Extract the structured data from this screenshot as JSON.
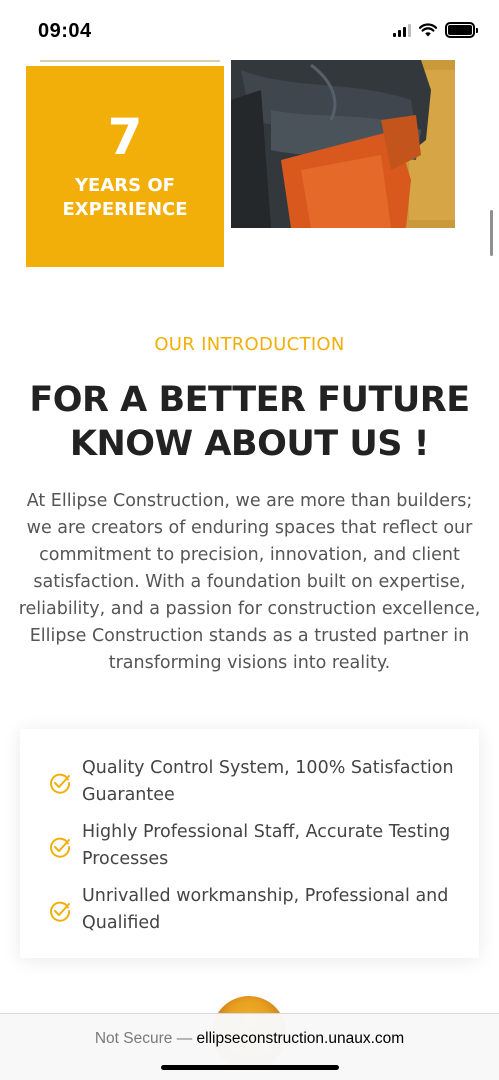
{
  "status_bar": {
    "time": "09:04"
  },
  "experience": {
    "number": "7",
    "label_line1": "YEARS OF",
    "label_line2": "EXPERIENCE",
    "color": "#f2af0a"
  },
  "intro": {
    "eyebrow": "OUR INTRODUCTION",
    "heading_line1": "FOR A BETTER FUTURE",
    "heading_line2": "KNOW ABOUT US !",
    "body": "At Ellipse Construction, we are more than builders; we are creators of enduring spaces that reflect our commitment to precision, innovation, and client satisfaction. With a foundation built on expertise, reliability, and a passion for construction excellence, Ellipse Construction stands as a trusted partner in transforming visions into reality."
  },
  "features": [
    {
      "text": "Quality Control System, 100% Satisfaction Guarantee",
      "icon": "check-badge-icon"
    },
    {
      "text": "Highly Professional Staff, Accurate Testing Processes",
      "icon": "check-badge-icon"
    },
    {
      "text": "Unrivalled workmanship, Professional and Qualified",
      "icon": "check-badge-icon"
    }
  ],
  "browser": {
    "not_secure": "Not Secure —",
    "domain": "ellipseconstruction.unaux.com"
  }
}
